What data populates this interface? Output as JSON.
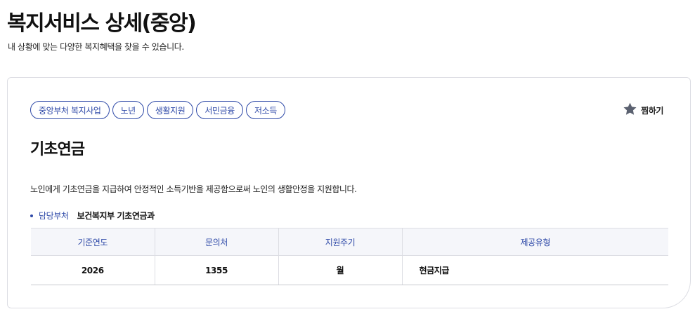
{
  "page": {
    "title": "복지서비스 상세(중앙)",
    "subtitle": "내 상황에 맞는 다양한 복지혜택을 찾을 수 있습니다."
  },
  "service": {
    "tags": [
      "중앙부처 복지사업",
      "노년",
      "생활지원",
      "서민금융",
      "저소득"
    ],
    "bookmark_label": "찜하기",
    "bookmark_icon": "star-icon",
    "name": "기초연금",
    "description": "노인에게 기초연금을 지급하여 안정적인 소득기반을 제공함으로써 노인의 생활안정을 지원합니다.",
    "department_label": "담당부처",
    "department_value": "보건복지부 기초연금과"
  },
  "table": {
    "headers": [
      "기준연도",
      "문의처",
      "지원주기",
      "제공유형"
    ],
    "row": [
      "2026",
      "1355",
      "월",
      "현금지급"
    ]
  },
  "colors": {
    "accent": "#2f4aa8",
    "table_header_bg": "#f5f6fa",
    "border": "#dcdde3",
    "star": "#5b6170"
  }
}
